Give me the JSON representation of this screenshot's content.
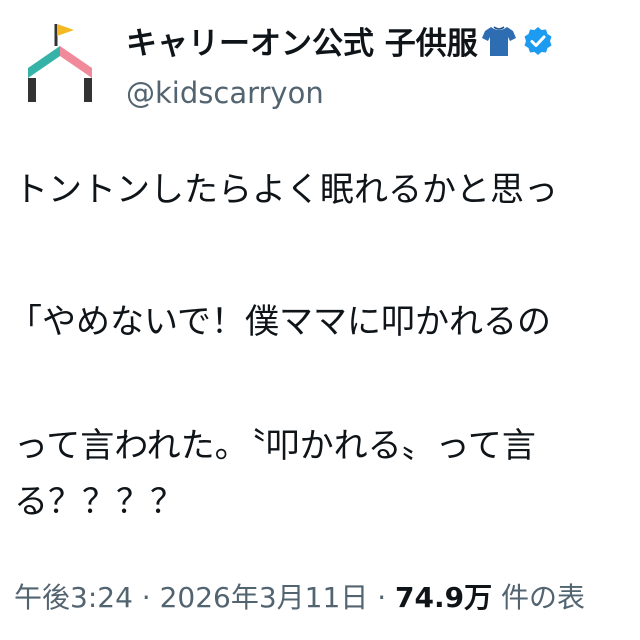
{
  "account": {
    "display_name": "キャリーオン公式 子供服",
    "handle": "@kidscarryon",
    "avatar_icon": "house-flag-logo-icon",
    "shirt_icon": "tshirt-emoji-icon",
    "verified_icon": "verified-badge-icon",
    "colors": {
      "verified": "#1d9bf0",
      "shirt": "#2f6db3",
      "logo_flag": "#f5b921",
      "logo_pink": "#f08a9a",
      "logo_teal": "#36b3a8",
      "logo_dark": "#333333"
    }
  },
  "tweet": {
    "lines": [
      "トントンしたらよく眠れるかと思っ",
      "「やめないで！僕ママに叩かれるの",
      "って言われた。〝叩かれる〟って言",
      "る？？？？"
    ]
  },
  "meta": {
    "time": "午後3:24",
    "separator1": " · ",
    "date": "2026年3月11日",
    "separator2": " · ",
    "views": "74.9万",
    "views_suffix": " 件の表"
  }
}
